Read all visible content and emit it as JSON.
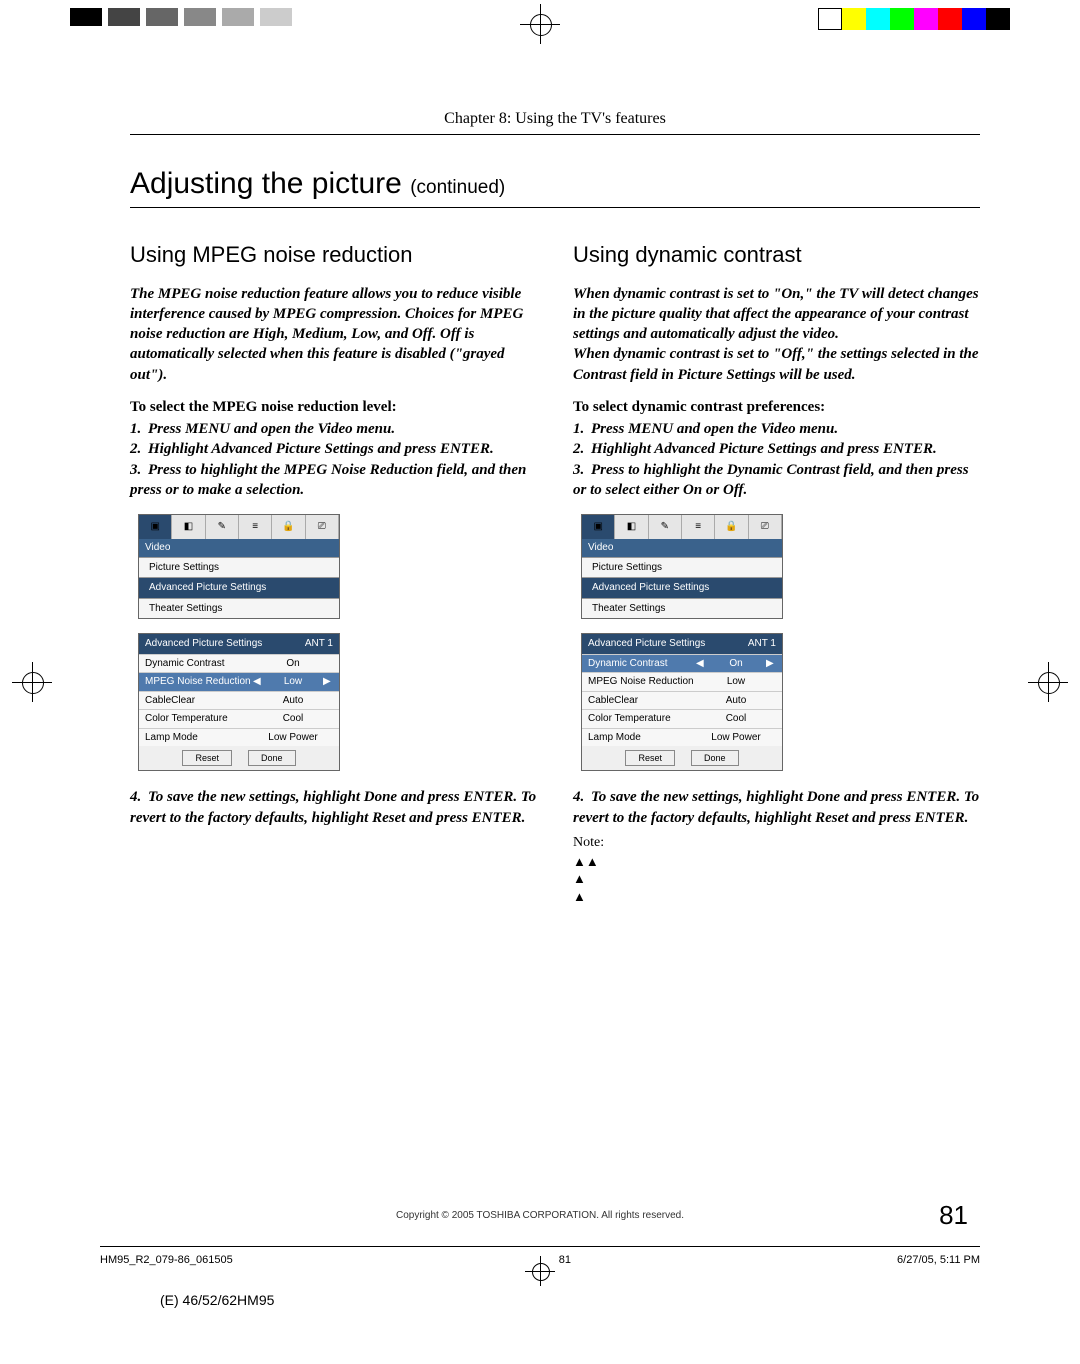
{
  "chapter": "Chapter 8: Using the TV's features",
  "h1": {
    "main": "Adjusting the picture",
    "cont": "(continued)"
  },
  "left": {
    "h2": "Using MPEG noise reduction",
    "intro": "The MPEG noise reduction feature allows you to reduce visible interference caused by MPEG compression. Choices for MPEG noise reduction are High, Medium, Low, and Off. Off is automatically selected when this feature is disabled (\"grayed out\").",
    "lead": "To select the MPEG noise reduction level:",
    "s1": "Press MENU and open the Video menu.",
    "s2": "Highlight Advanced Picture Settings and press ENTER.",
    "s3a": "Press ",
    "s3b": " to highlight the MPEG Noise Reduction field, and then press  or  to make a selection.",
    "s4": "To save the new settings, highlight Done and press ENTER. To revert to the factory defaults, highlight Reset and press ENTER."
  },
  "right": {
    "h2": "Using dynamic contrast",
    "intro": "When dynamic contrast is set to \"On,\" the TV will detect changes in the picture quality that affect the appearance of your contrast settings and automatically adjust the video.\nWhen dynamic contrast is set to \"Off,\" the settings selected in the Contrast field in Picture Settings will be used.",
    "lead": "To select dynamic contrast preferences:",
    "s1": "Press MENU and open the Video menu.",
    "s2": "Highlight Advanced Picture Settings and press ENTER.",
    "s3a": "Press ",
    "s3b": " to highlight the Dynamic Contrast field, and then press  or  to select either On or Off.",
    "s4": "To save the new settings, highlight Done and press ENTER. To revert to the factory defaults, highlight Reset and press ENTER.",
    "note": "Note:"
  },
  "menu": {
    "videoLabel": "Video",
    "items": [
      "Picture Settings",
      "Advanced Picture Settings",
      "Theater Settings"
    ]
  },
  "advLeft": {
    "title": "Advanced Picture Settings",
    "ant": "ANT 1",
    "rows": [
      {
        "lbl": "Dynamic Contrast",
        "val": "On"
      },
      {
        "lbl": "MPEG Noise Reduction",
        "val": "Low",
        "sel": true
      },
      {
        "lbl": "CableClear",
        "val": "Auto"
      },
      {
        "lbl": "Color Temperature",
        "val": "Cool"
      },
      {
        "lbl": "Lamp Mode",
        "val": "Low Power"
      }
    ],
    "reset": "Reset",
    "done": "Done"
  },
  "advRight": {
    "title": "Advanced Picture Settings",
    "ant": "ANT 1",
    "rows": [
      {
        "lbl": "Dynamic Contrast",
        "val": "On",
        "sel": true
      },
      {
        "lbl": "MPEG Noise Reduction",
        "val": "Low"
      },
      {
        "lbl": "CableClear",
        "val": "Auto"
      },
      {
        "lbl": "Color Temperature",
        "val": "Cool"
      },
      {
        "lbl": "Lamp Mode",
        "val": "Low Power"
      }
    ],
    "reset": "Reset",
    "done": "Done"
  },
  "pagenum": "81",
  "copyright": "Copyright © 2005 TOSHIBA CORPORATION. All rights reserved.",
  "footer": {
    "file": "HM95_R2_079-86_061505",
    "pg": "81",
    "ts": "6/27/05, 5:11 PM"
  },
  "model": "(E) 46/52/62HM95"
}
